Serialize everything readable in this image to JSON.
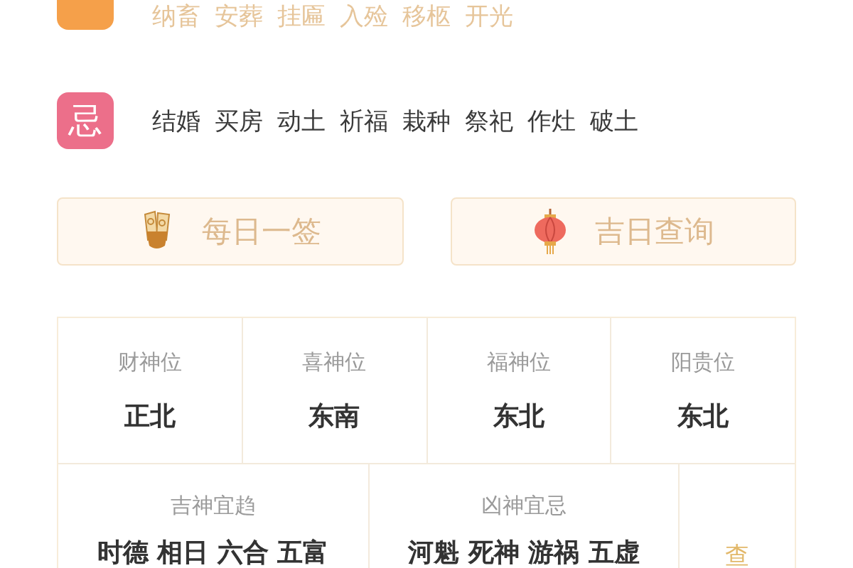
{
  "suitable": {
    "items": [
      "纳畜",
      "安葬",
      "挂匾",
      "入殓",
      "移柩",
      "开光"
    ]
  },
  "avoid": {
    "badge": "忌",
    "items": [
      "结婚",
      "买房",
      "动土",
      "祈福",
      "栽种",
      "祭祀",
      "作灶",
      "破土"
    ]
  },
  "buttons": [
    {
      "label": "每日一签",
      "kind": "sticks"
    },
    {
      "label": "吉日查询",
      "kind": "lantern"
    }
  ],
  "directions": [
    {
      "label": "财神位",
      "value": "正北"
    },
    {
      "label": "喜神位",
      "value": "东南"
    },
    {
      "label": "福神位",
      "value": "东北"
    },
    {
      "label": "阳贵位",
      "value": "东北"
    }
  ],
  "gods": [
    {
      "label": "吉神宜趋",
      "value": "时德 相日 六合 五富"
    },
    {
      "label": "凶神宜忌",
      "value": "河魁 死神 游祸 五虚"
    }
  ],
  "more": "查"
}
